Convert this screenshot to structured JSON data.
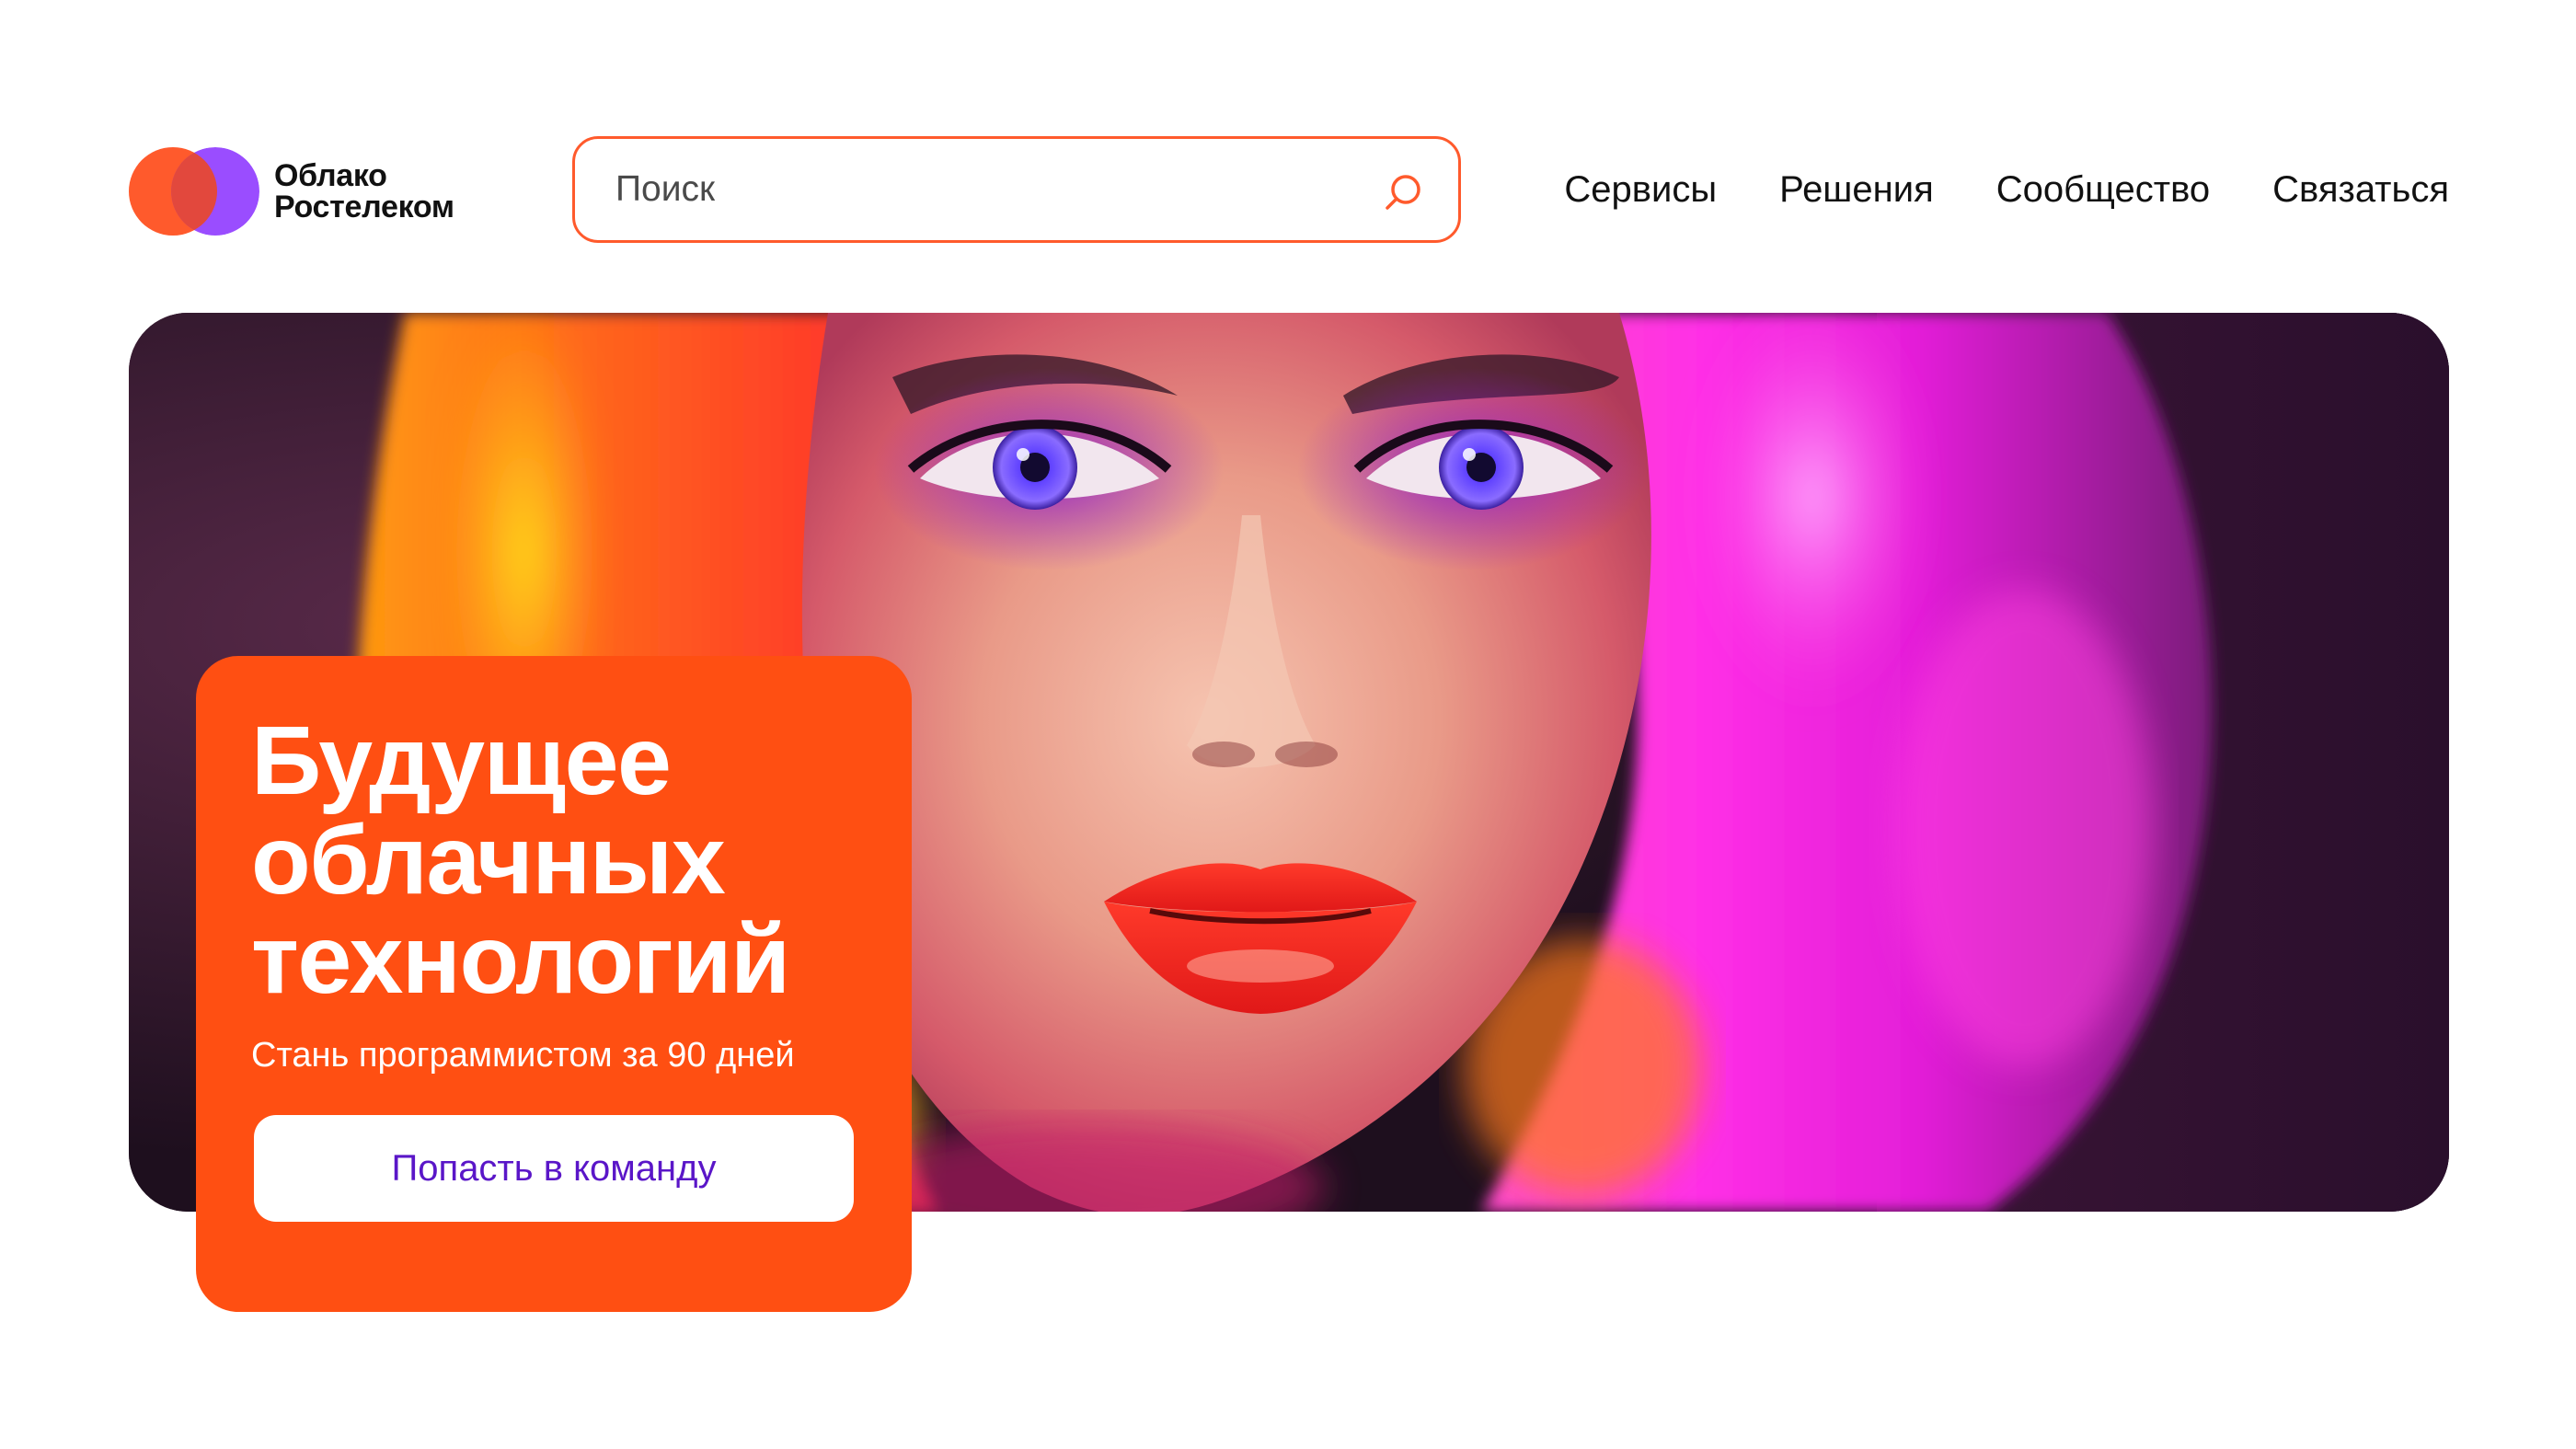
{
  "logo": {
    "line1": "Облако",
    "line2": "Ростелеком"
  },
  "search": {
    "placeholder": "Поиск"
  },
  "nav": {
    "items": [
      "Сервисы",
      "Решения",
      "Сообщество",
      "Связаться"
    ]
  },
  "hero": {
    "image": "neon-portrait-woman"
  },
  "promo": {
    "title_line1": "Будущее",
    "title_line2": "облачных",
    "title_line3": "технологий",
    "subtitle": "Стань программистом за 90 дней",
    "button_label": "Попасть в команду"
  },
  "colors": {
    "accent_orange": "#ff4f12",
    "brand_purple": "#8a3ffc",
    "button_text": "#5a16c8"
  }
}
